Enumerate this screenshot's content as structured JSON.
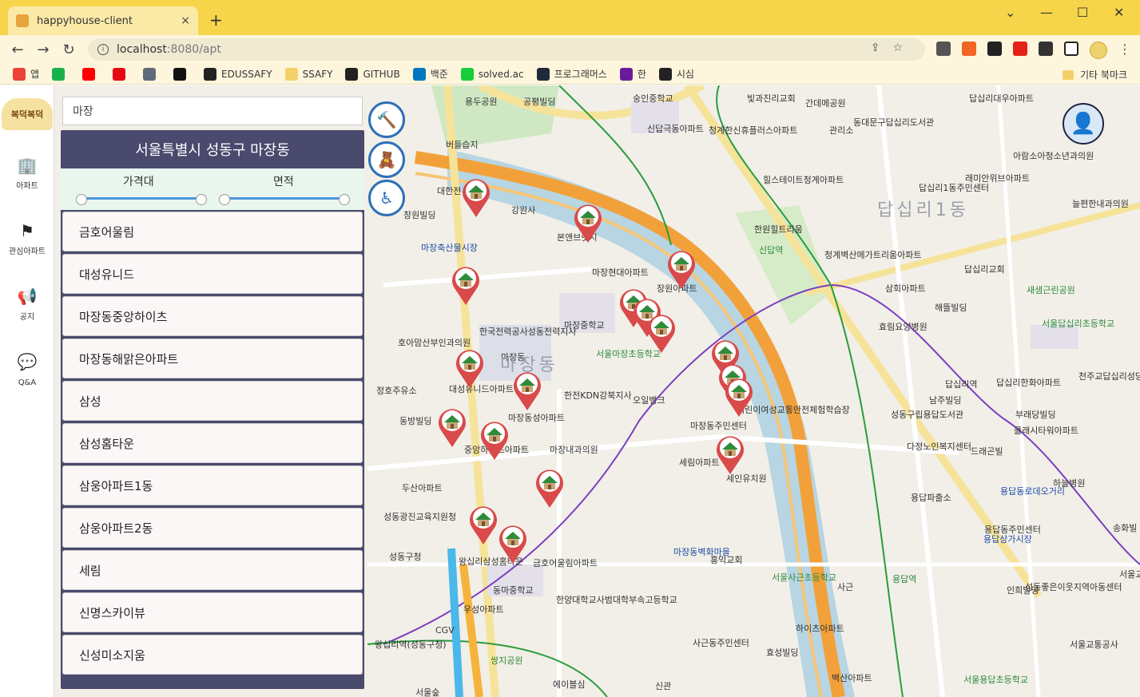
{
  "browser": {
    "tab_title": "happyhouse-client",
    "tab_close": "×",
    "new_tab": "+",
    "win_min": "—",
    "win_max": "☐",
    "win_close": "✕",
    "url_host": "localhost",
    "url_path": ":8080/apt",
    "omni_icons": "⇪☆",
    "menu": "⋮",
    "bookmarks": [
      {
        "label": "앱",
        "color": "#ea4335"
      },
      {
        "label": "",
        "color": "#18b24b"
      },
      {
        "label": "",
        "color": "#ff0000"
      },
      {
        "label": "",
        "color": "#e50914"
      },
      {
        "label": "",
        "color": "#5f6b7a"
      },
      {
        "label": "",
        "color": "#111111"
      },
      {
        "label": "EDUSSAFY",
        "color": "#222222"
      },
      {
        "label": "SSAFY",
        "color": "#f5cf6a"
      },
      {
        "label": "GITHUB",
        "color": "#222222"
      },
      {
        "label": "백준",
        "color": "#0076c0"
      },
      {
        "label": "solved.ac",
        "color": "#17ce3a"
      },
      {
        "label": "프로그래머스",
        "color": "#1e2a3a"
      },
      {
        "label": "한",
        "color": "#6a1b9a"
      },
      {
        "label": "시심",
        "color": "#222222"
      }
    ],
    "bookmark_other": "기타 북마크"
  },
  "sidenav": {
    "logo": "복덕복덕",
    "items": [
      {
        "icon": "🏢",
        "label": "아파트"
      },
      {
        "icon": "⚑",
        "label": "관심아파트"
      },
      {
        "icon": "📢",
        "label": "공지"
      },
      {
        "icon": "💬",
        "label": "Q&A"
      }
    ]
  },
  "search": {
    "value": "마장"
  },
  "panel": {
    "title": "서울특별시 성동구 마장동",
    "filter_price_label": "가격대",
    "filter_area_label": "면적",
    "apartments": [
      "금호어울림",
      "대성유니드",
      "마장동중앙하이츠",
      "마장동해맑은아파트",
      "삼성",
      "삼성홈타운",
      "삼웅아파트1동",
      "삼웅아파트2동",
      "세림",
      "신명스카이뷰",
      "신성미소지움"
    ]
  },
  "map_buttons": [
    {
      "name": "hammer",
      "icon": "🔨"
    },
    {
      "name": "teddy",
      "icon": "🧸"
    },
    {
      "name": "wheelchair",
      "icon": "♿"
    }
  ],
  "user_icon": "👤",
  "map": {
    "district_label": "마장동",
    "district_label_2": "답십리1동",
    "labels": [
      {
        "text": "용두공원",
        "color": "dark"
      },
      {
        "text": "공평빌딩",
        "color": "dark"
      },
      {
        "text": "숭인중학교",
        "color": "dark"
      },
      {
        "text": "빛과진리교회",
        "color": "dark"
      },
      {
        "text": "간데메공원",
        "color": "dark"
      },
      {
        "text": "답십리대우아파트",
        "color": "dark"
      },
      {
        "text": "신답극동아파트",
        "color": "dark"
      },
      {
        "text": "청계한신휴플러스아파트",
        "color": "dark"
      },
      {
        "text": "관리소",
        "color": "dark"
      },
      {
        "text": "동대문구답십리도서관",
        "color": "dark"
      },
      {
        "text": "아람소아청소년과의원",
        "color": "dark"
      },
      {
        "text": "버들습지",
        "color": "dark"
      },
      {
        "text": "힐스테이트청계아파트",
        "color": "dark"
      },
      {
        "text": "래미안위브아파트",
        "color": "dark"
      },
      {
        "text": "대한전",
        "color": "dark"
      },
      {
        "text": "답십리1동주민센터",
        "color": "dark"
      },
      {
        "text": "늘편한내과의원",
        "color": "dark"
      },
      {
        "text": "창원빌딩",
        "color": "dark"
      },
      {
        "text": "강원사",
        "color": "dark"
      },
      {
        "text": "본앤브릿지",
        "color": "dark"
      },
      {
        "text": "한원힐트리움",
        "color": "dark"
      },
      {
        "text": "마장축산물시장",
        "color": "blue"
      },
      {
        "text": "마장현대아파트",
        "color": "dark"
      },
      {
        "text": "장원아파트",
        "color": "dark"
      },
      {
        "text": "청계벽산메가트리움아파트",
        "color": "dark"
      },
      {
        "text": "답십리교회",
        "color": "dark"
      },
      {
        "text": "삼희아파트",
        "color": "dark"
      },
      {
        "text": "새샘근린공원",
        "color": "green"
      },
      {
        "text": "해뜰빌딩",
        "color": "dark"
      },
      {
        "text": "한국전력공사성동전력지사",
        "color": "dark"
      },
      {
        "text": "마장중학교",
        "color": "dark"
      },
      {
        "text": "효림요양병원",
        "color": "dark"
      },
      {
        "text": "서울답십리초등학교",
        "color": "green"
      },
      {
        "text": "호아맘산부인과의원",
        "color": "dark"
      },
      {
        "text": "서울마장초등학교",
        "color": "green"
      },
      {
        "text": "마장동",
        "color": "dark"
      },
      {
        "text": "정호주유소",
        "color": "dark"
      },
      {
        "text": "대성유니드아파트",
        "color": "dark"
      },
      {
        "text": "한전KDN강북지사",
        "color": "dark"
      },
      {
        "text": "오일뱅크",
        "color": "dark"
      },
      {
        "text": "어린이여성교통안전체험학습장",
        "color": "dark"
      },
      {
        "text": "답십리한화아파트",
        "color": "dark"
      },
      {
        "text": "천주교답십리성당",
        "color": "dark"
      },
      {
        "text": "동방빌딩",
        "color": "dark"
      },
      {
        "text": "마장동성아파트",
        "color": "dark"
      },
      {
        "text": "마장동주민센터",
        "color": "dark"
      },
      {
        "text": "남주빌딩",
        "color": "dark"
      },
      {
        "text": "부래당빌딩",
        "color": "dark"
      },
      {
        "text": "성동구립용답도서관",
        "color": "dark"
      },
      {
        "text": "클래시타워아파트",
        "color": "dark"
      },
      {
        "text": "중앙하이츠아파트",
        "color": "dark"
      },
      {
        "text": "마장내과의원",
        "color": "dark"
      },
      {
        "text": "세림아파트",
        "color": "dark"
      },
      {
        "text": "다정노인복지센터",
        "color": "dark"
      },
      {
        "text": "드래곤빌",
        "color": "dark"
      },
      {
        "text": "두산아파트",
        "color": "dark"
      },
      {
        "text": "세인유치원",
        "color": "dark"
      },
      {
        "text": "하늘병원",
        "color": "dark"
      },
      {
        "text": "용답파출소",
        "color": "dark"
      },
      {
        "text": "용답동로데오거리",
        "color": "blue"
      },
      {
        "text": "성동광진교육지원청",
        "color": "dark"
      },
      {
        "text": "용답동주민센터",
        "color": "dark"
      },
      {
        "text": "용답상가시장",
        "color": "blue"
      },
      {
        "text": "송화빌",
        "color": "dark"
      },
      {
        "text": "성동구청",
        "color": "dark"
      },
      {
        "text": "왕십리삼성홈타운",
        "color": "dark"
      },
      {
        "text": "금호어울림아파트",
        "color": "dark"
      },
      {
        "text": "마장동벽화마을",
        "color": "blue"
      },
      {
        "text": "홍익교회",
        "color": "dark"
      },
      {
        "text": "서울사근초등학교",
        "color": "green"
      },
      {
        "text": "사근",
        "color": "dark"
      },
      {
        "text": "서울교통공사본사",
        "color": "dark"
      },
      {
        "text": "동마중학교",
        "color": "dark"
      },
      {
        "text": "인희빌딩",
        "color": "dark"
      },
      {
        "text": "우성아파트",
        "color": "dark"
      },
      {
        "text": "한양대학교사범대학부속고등학교",
        "color": "dark"
      },
      {
        "text": "하이츠아파트",
        "color": "dark"
      },
      {
        "text": "성동좋은이웃지역아동센터",
        "color": "dark"
      },
      {
        "text": "CGV",
        "color": "dark"
      },
      {
        "text": "사근동주민센터",
        "color": "dark"
      },
      {
        "text": "효성빌딩",
        "color": "dark"
      },
      {
        "text": "서울교통공사",
        "color": "dark"
      },
      {
        "text": "쌍지공원",
        "color": "green"
      },
      {
        "text": "왕십리역(성동구청)",
        "color": "dark"
      },
      {
        "text": "벽산아파트",
        "color": "dark"
      },
      {
        "text": "서울용답초등학교",
        "color": "green"
      },
      {
        "text": "에이블심",
        "color": "dark"
      },
      {
        "text": "신관",
        "color": "dark"
      },
      {
        "text": "서울숲",
        "color": "dark"
      },
      {
        "text": "용답역",
        "color": "green"
      },
      {
        "text": "답십리역",
        "color": "dark"
      },
      {
        "text": "신답역",
        "color": "green"
      },
      {
        "text": "10m Kakao",
        "color": "dark"
      }
    ]
  }
}
